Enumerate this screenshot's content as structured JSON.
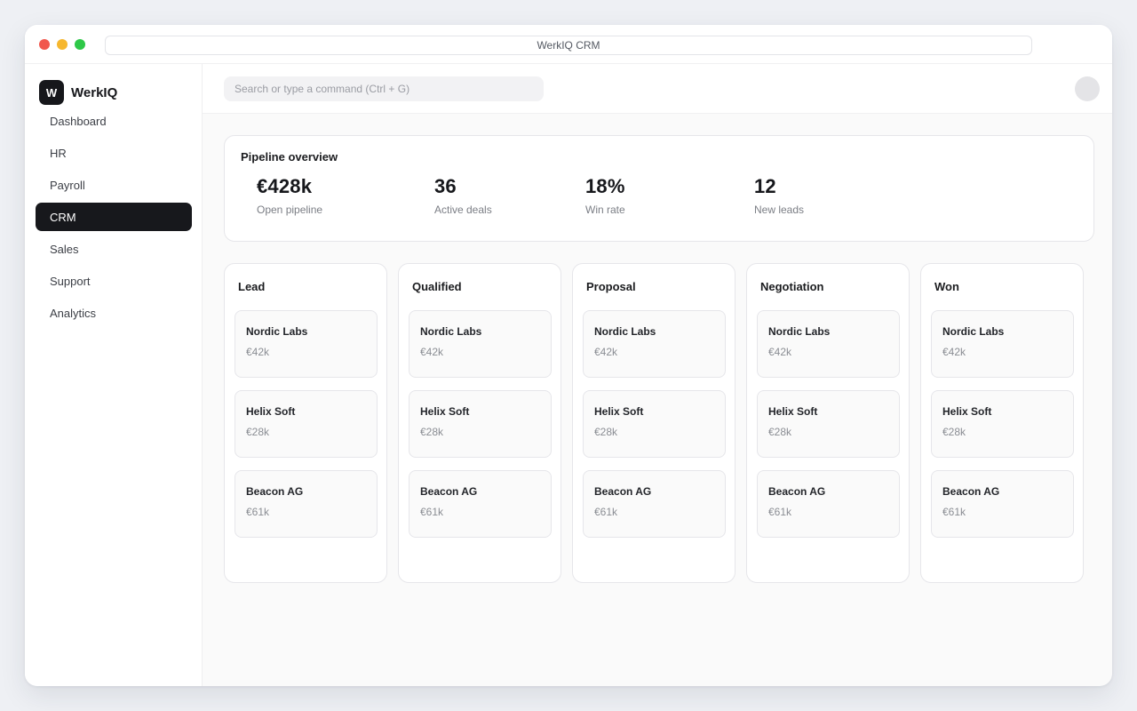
{
  "window": {
    "title": "WerkIQ CRM"
  },
  "brand": {
    "logo_letter": "W",
    "name": "WerkIQ"
  },
  "sidebar": {
    "items": [
      {
        "label": "Dashboard",
        "active": false
      },
      {
        "label": "HR",
        "active": false
      },
      {
        "label": "Payroll",
        "active": false
      },
      {
        "label": "CRM",
        "active": true
      },
      {
        "label": "Sales",
        "active": false
      },
      {
        "label": "Support",
        "active": false
      },
      {
        "label": "Analytics",
        "active": false
      }
    ]
  },
  "search": {
    "placeholder": "Search or type a command (Ctrl + G)",
    "value": ""
  },
  "overview": {
    "title": "Pipeline overview",
    "stats": [
      {
        "value": "€428k",
        "label": "Open pipeline"
      },
      {
        "value": "36",
        "label": "Active deals"
      },
      {
        "value": "18%",
        "label": "Win rate"
      },
      {
        "value": "12",
        "label": "New leads"
      }
    ]
  },
  "board": {
    "columns": [
      {
        "title": "Lead",
        "cards": [
          {
            "name": "Nordic Labs",
            "amount": "€42k"
          },
          {
            "name": "Helix Soft",
            "amount": "€28k"
          },
          {
            "name": "Beacon AG",
            "amount": "€61k"
          }
        ]
      },
      {
        "title": "Qualified",
        "cards": [
          {
            "name": "Nordic Labs",
            "amount": "€42k"
          },
          {
            "name": "Helix Soft",
            "amount": "€28k"
          },
          {
            "name": "Beacon AG",
            "amount": "€61k"
          }
        ]
      },
      {
        "title": "Proposal",
        "cards": [
          {
            "name": "Nordic Labs",
            "amount": "€42k"
          },
          {
            "name": "Helix Soft",
            "amount": "€28k"
          },
          {
            "name": "Beacon AG",
            "amount": "€61k"
          }
        ]
      },
      {
        "title": "Negotiation",
        "cards": [
          {
            "name": "Nordic Labs",
            "amount": "€42k"
          },
          {
            "name": "Helix Soft",
            "amount": "€28k"
          },
          {
            "name": "Beacon AG",
            "amount": "€61k"
          }
        ]
      },
      {
        "title": "Won",
        "cards": [
          {
            "name": "Nordic Labs",
            "amount": "€42k"
          },
          {
            "name": "Helix Soft",
            "amount": "€28k"
          },
          {
            "name": "Beacon AG",
            "amount": "€61k"
          }
        ]
      }
    ]
  },
  "colors": {
    "accent": "#17181c",
    "traffic_red": "#f1574d",
    "traffic_yellow": "#f6b72f",
    "traffic_green": "#2ec848"
  }
}
